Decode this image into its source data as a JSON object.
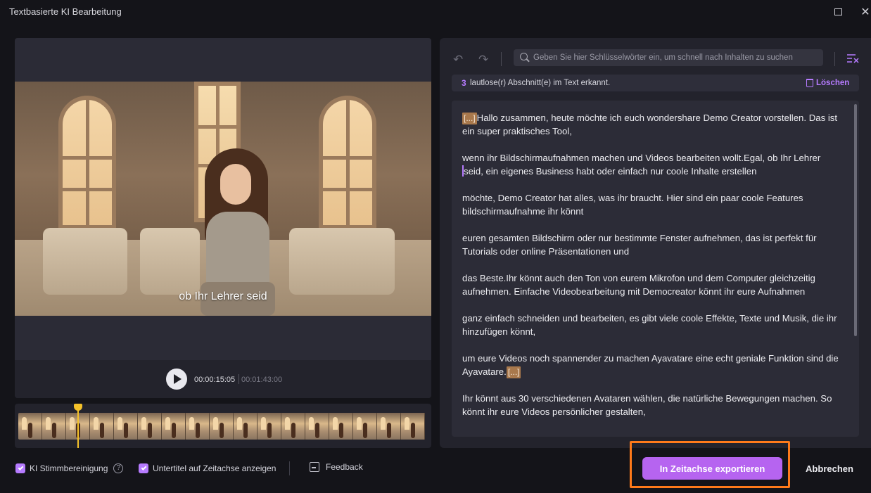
{
  "window": {
    "title": "Textbasierte KI Bearbeitung"
  },
  "player": {
    "subtitle": "ob Ihr Lehrer seid",
    "current_time": "00:00:15:05",
    "total_time": "00:01:43:00"
  },
  "transcript": {
    "search_placeholder": "Geben Sie hier Schlüsselwörter ein, um schnell nach Inhalten zu suchen",
    "notice_count": "3",
    "notice_text": "lautlose(r) Abschnitt(e) im Text erkannt.",
    "delete_label": "Löschen",
    "silence_tag": "[...]",
    "p1": "Hallo zusammen, heute möchte ich euch wondershare Demo Creator vorstellen. Das ist ein super praktisches Tool,",
    "p2a": " wenn ihr Bildschirmaufnahmen machen und Videos bearbeiten wollt.Egal, ob Ihr Lehrer ",
    "p2b": "seid, ein eigenes Business habt oder einfach nur coole Inhalte erstellen",
    "p3": " möchte, Demo Creator hat alles, was ihr braucht. Hier sind ein paar coole Features bildschirmaufnahme ihr könnt",
    "p4": " euren gesamten Bildschirm oder nur bestimmte Fenster aufnehmen, das ist perfekt für Tutorials oder online Präsentationen und",
    "p5": " das Beste.Ihr könnt auch den Ton von eurem Mikrofon und dem Computer gleichzeitig aufnehmen. Einfache Videobearbeitung mit Democreator könnt ihr eure Aufnahmen",
    "p6": " ganz einfach schneiden und bearbeiten, es gibt viele coole Effekte, Texte und Musik, die ihr hinzufügen könnt,",
    "p7": " um eure Videos noch spannender zu machen Ayavatare eine echt geniale Funktion sind die Ayavatare.",
    "p8": "Ihr könnt aus 30 verschiedenen Avataren wählen, die natürliche Bewegungen machen. So könnt ihr eure Videos persönlicher gestalten,"
  },
  "footer": {
    "voice_cleanup_label": "KI Stimmbereinigung",
    "voice_cleanup_checked": true,
    "subtitles_label": "Untertitel auf Zeitachse anzeigen",
    "subtitles_checked": true,
    "help_glyph": "?",
    "feedback_label": "Feedback",
    "export_label": "In Zeitachse exportieren",
    "cancel_label": "Abbrechen"
  },
  "colors": {
    "accent": "#b664f0",
    "highlight": "#ff7a1a",
    "silence_tag": "#a8784c",
    "background": "#141419"
  },
  "icons": [
    "maximize-icon",
    "close-icon",
    "play-icon",
    "undo-icon",
    "redo-icon",
    "search-icon",
    "clear-format-icon",
    "trash-icon",
    "check-icon",
    "help-icon",
    "feedback-icon"
  ]
}
